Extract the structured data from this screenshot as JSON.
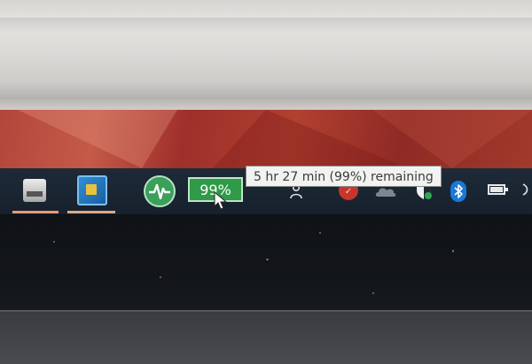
{
  "taskbar": {
    "battery_percent_label": "99%",
    "tooltip": "5 hr 27 min (99%) remaining",
    "battery_level_fraction": 0.99
  },
  "icons": {
    "app1": "printer-app-icon",
    "app2": "intel-graphics-icon",
    "pulse": "activity-monitor-icon",
    "person": "person-icon",
    "red_badge": "notification-badge-icon",
    "cloud": "onedrive-cloud-icon",
    "shield": "security-shield-icon",
    "bluetooth": "bluetooth-icon",
    "battery": "battery-icon",
    "wifi": "wifi-icon"
  },
  "colors": {
    "taskbar": "#1e2a38",
    "battery_badge": "#2f9a47",
    "bluetooth": "#1a78d6",
    "wallpaper_red": "#b1402f"
  }
}
